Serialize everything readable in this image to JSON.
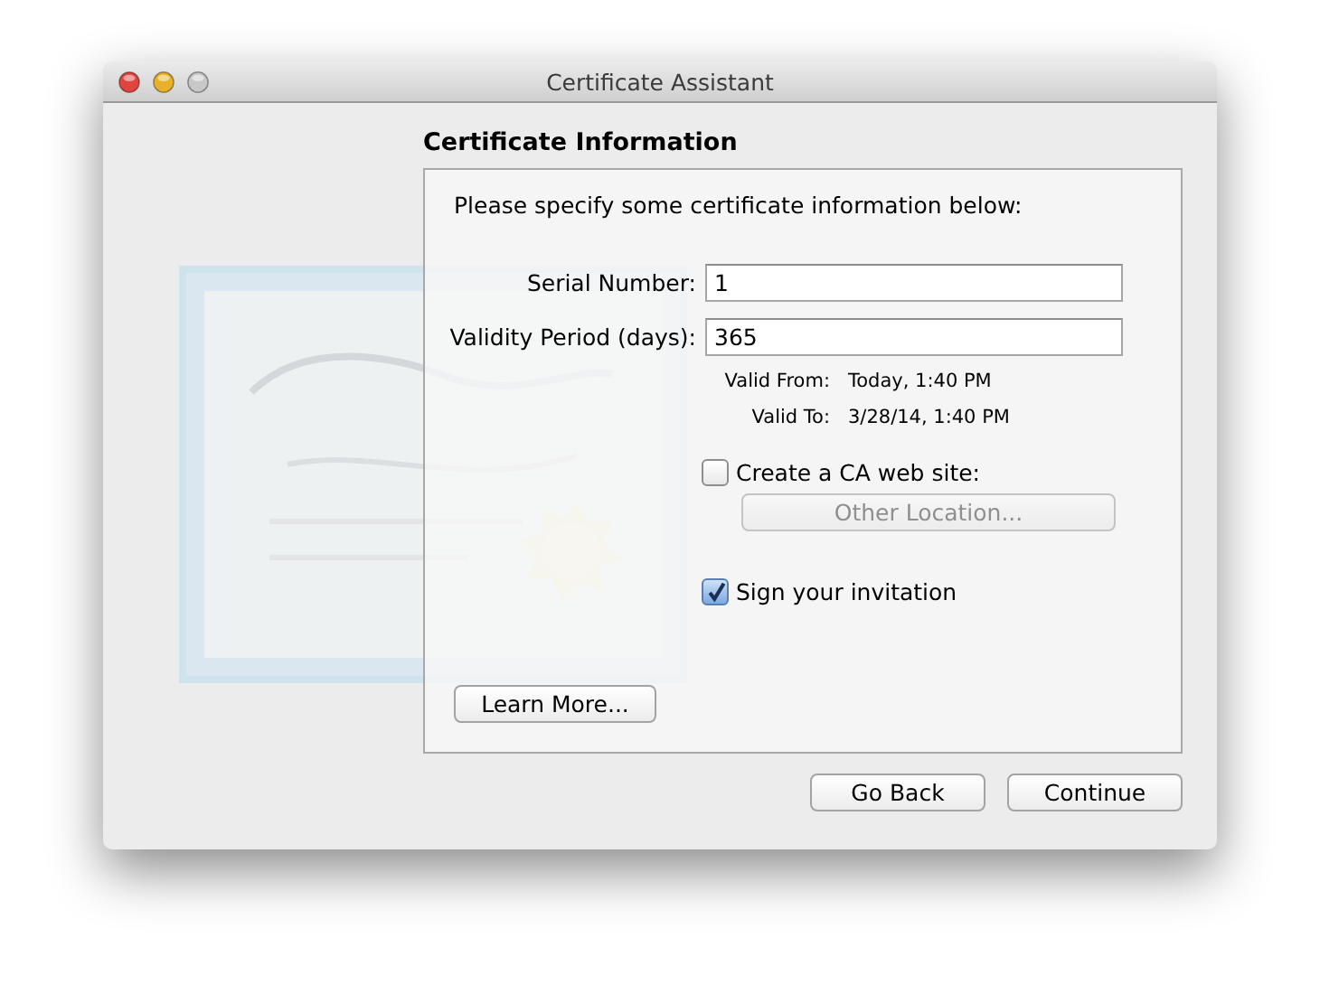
{
  "window": {
    "title": "Certificate Assistant",
    "controls": [
      {
        "kind": "close",
        "disabled": false
      },
      {
        "kind": "minimize",
        "disabled": false
      },
      {
        "kind": "zoom",
        "disabled": true
      }
    ]
  },
  "heading": "Certificate Information",
  "intro": "Please specify some certificate information below:",
  "fields": [
    {
      "label": "Serial Number:",
      "value": "1"
    },
    {
      "label": "Validity Period (days):",
      "value": "365"
    }
  ],
  "validity": [
    {
      "label": "Valid From:",
      "value": "Today, 1:40 PM"
    },
    {
      "label": "Valid To:",
      "value": "3/28/14, 1:40 PM"
    }
  ],
  "ca_web_site": {
    "label": "Create a CA web site:",
    "checked": false,
    "button": {
      "label": "Other Location...",
      "disabled": true
    }
  },
  "sign_invitation": {
    "label": "Sign your invitation",
    "checked": true
  },
  "learn_more": "Learn More...",
  "buttons": [
    "Go Back",
    "Continue"
  ]
}
